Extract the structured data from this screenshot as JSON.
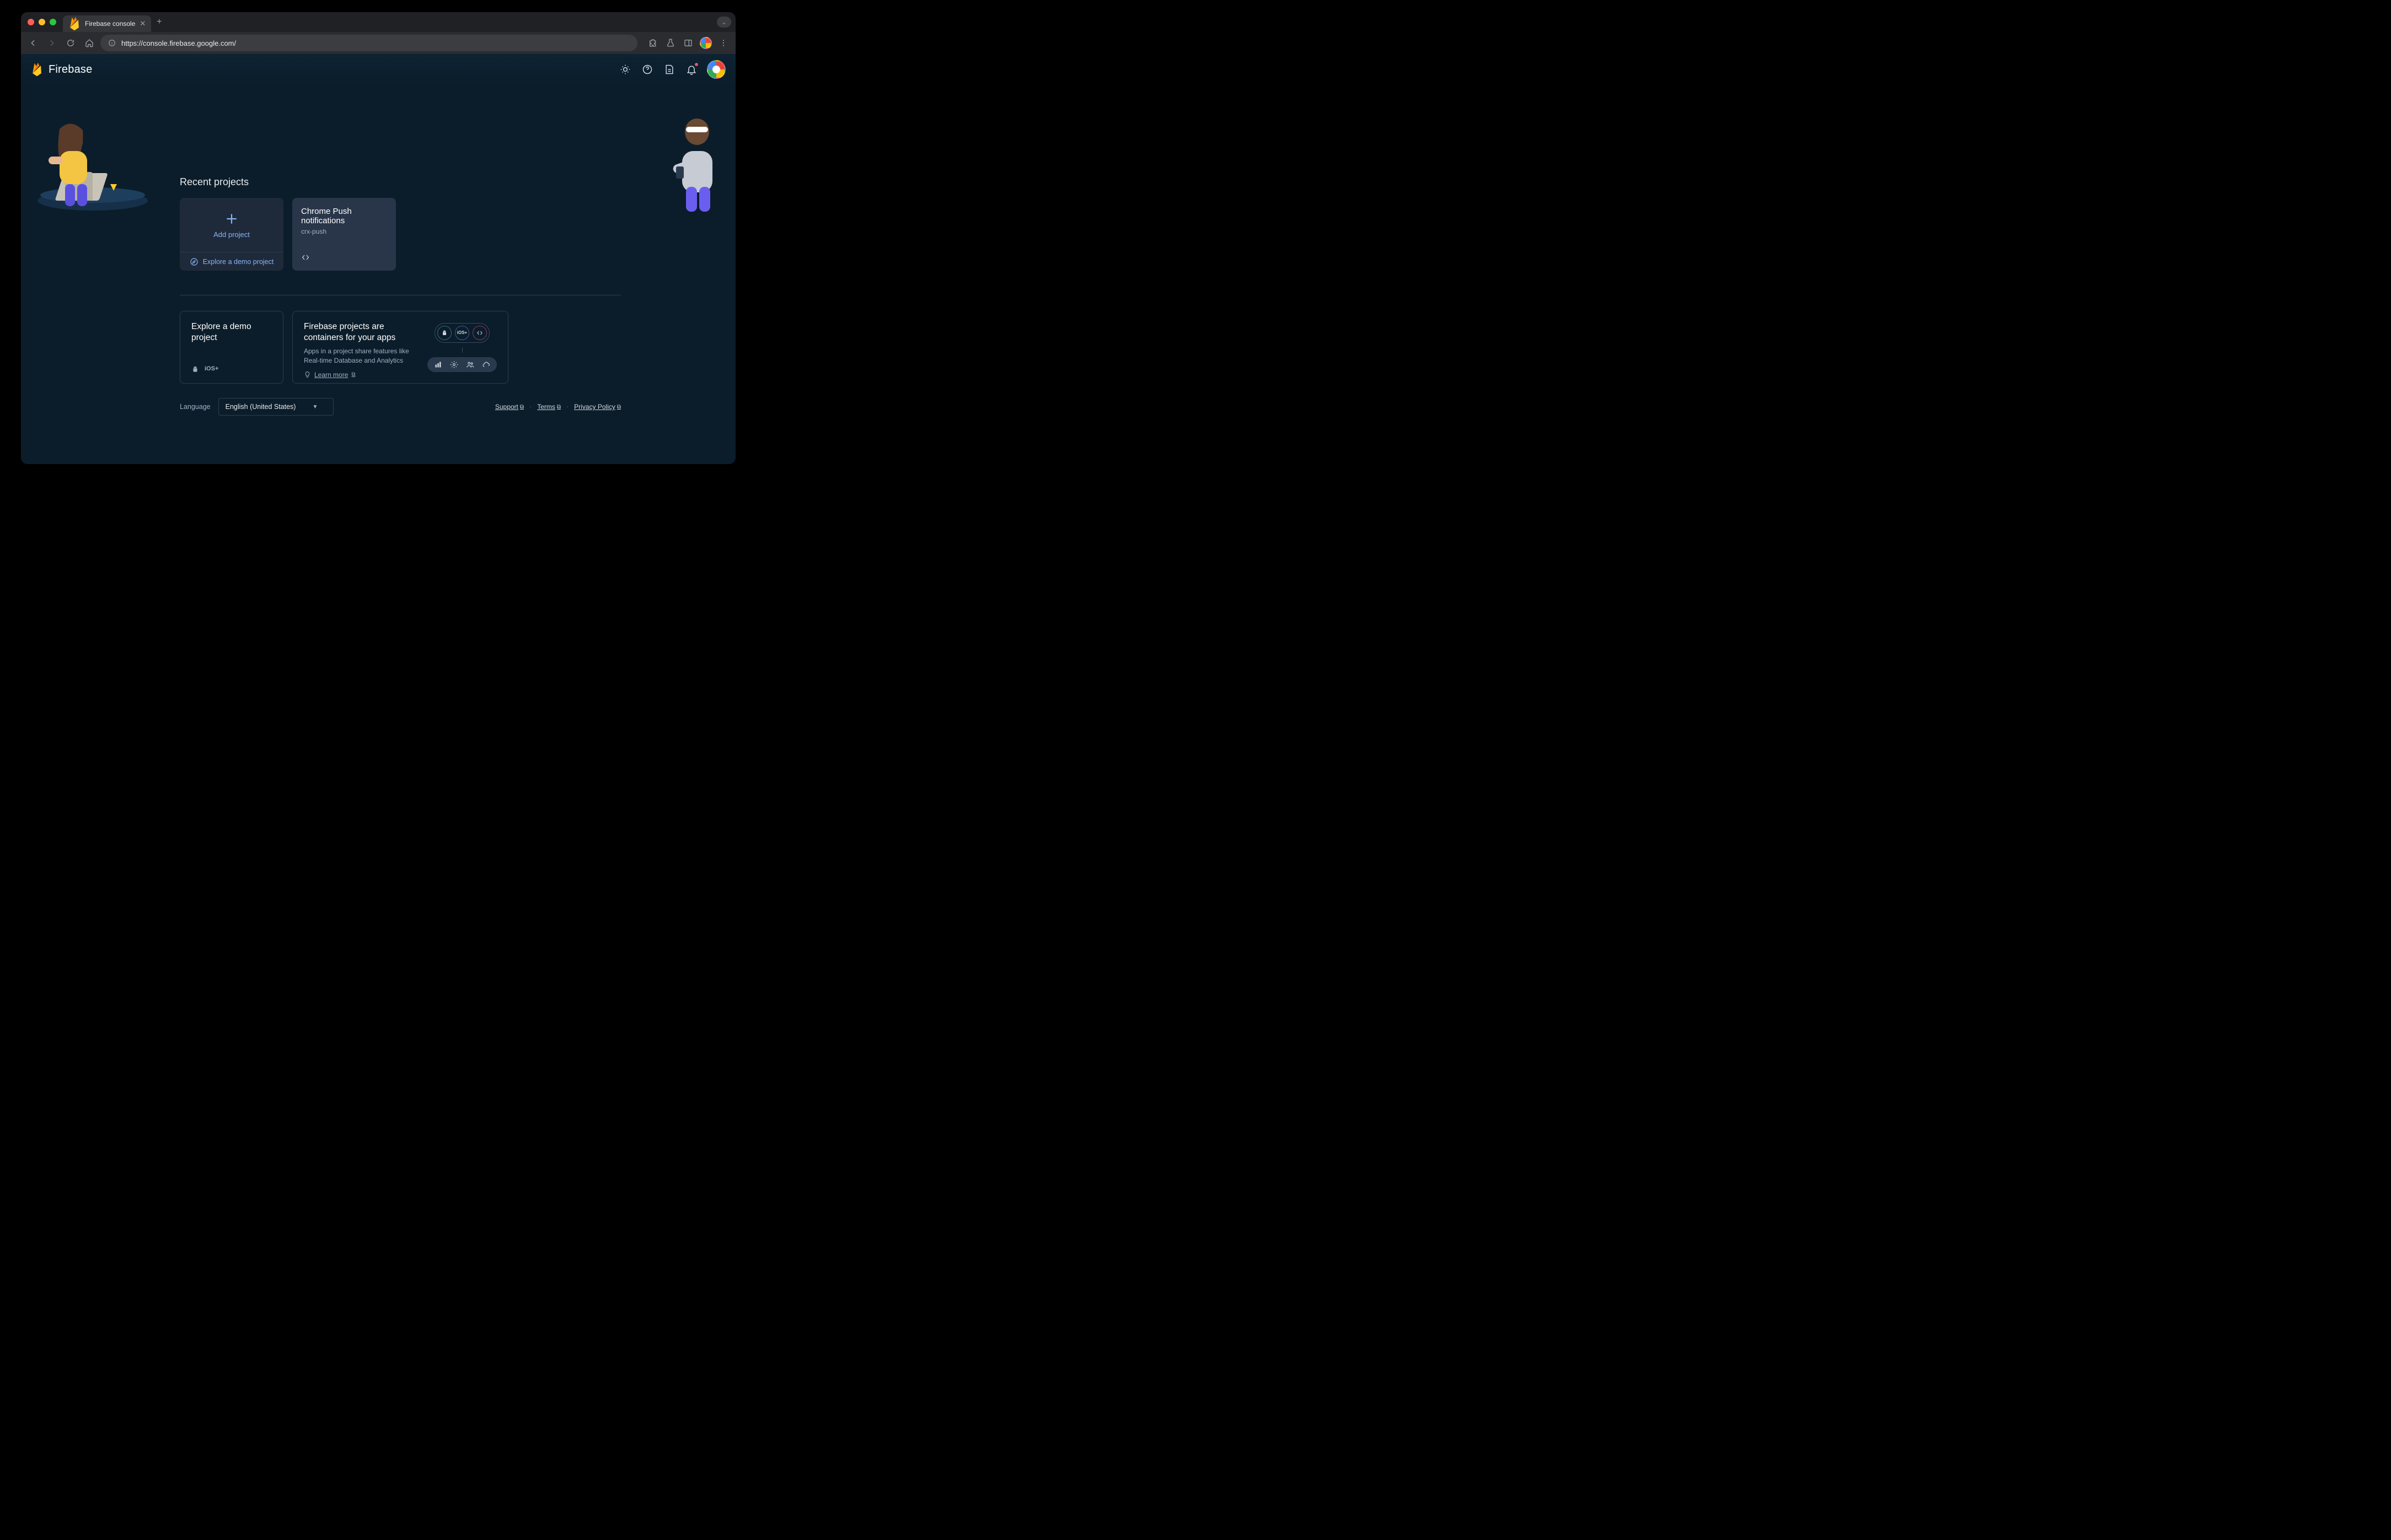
{
  "browser": {
    "tab_title": "Firebase console",
    "url": "https://console.firebase.google.com/"
  },
  "header": {
    "brand": "Firebase"
  },
  "recent": {
    "title": "Recent projects",
    "add_label": "Add project",
    "demo_label": "Explore a demo project",
    "projects": [
      {
        "name": "Chrome Push notifications",
        "id": "crx-push"
      }
    ]
  },
  "explore_card": {
    "title": "Explore a demo project"
  },
  "containers_card": {
    "title": "Firebase projects are containers for your apps",
    "subtitle": "Apps in a project share features like Real-time Database and Analytics",
    "learn_more": "Learn more"
  },
  "footer": {
    "language_label": "Language",
    "language_value": "English (United States)",
    "links": {
      "support": "Support",
      "terms": "Terms",
      "privacy": "Privacy Policy"
    }
  }
}
